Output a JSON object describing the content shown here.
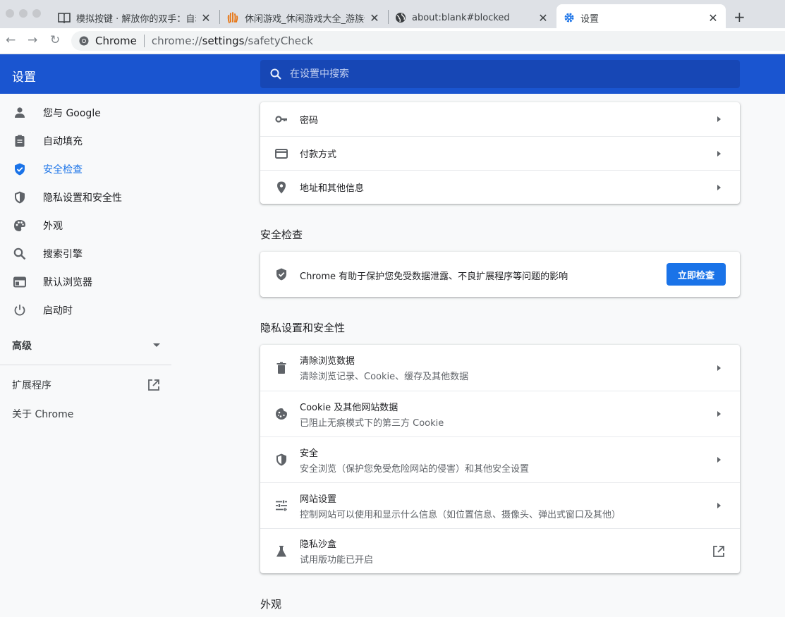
{
  "browser": {
    "tabs": [
      {
        "title": "模拟按键 · 解放你的双手：自动化"
      },
      {
        "title": "休闲游戏_休闲游戏大全_游族休闲"
      },
      {
        "title": "about:blank#blocked"
      },
      {
        "title": "设置"
      }
    ],
    "omnibox": {
      "site": "Chrome",
      "url_host": "chrome://",
      "url_path": "settings",
      "url_rest": "/safetyCheck"
    }
  },
  "header": {
    "title": "设置",
    "search_placeholder": "在设置中搜索"
  },
  "sidebar": {
    "items": [
      {
        "label": "您与 Google"
      },
      {
        "label": "自动填充"
      },
      {
        "label": "安全检查"
      },
      {
        "label": "隐私设置和安全性"
      },
      {
        "label": "外观"
      },
      {
        "label": "搜索引擎"
      },
      {
        "label": "默认浏览器"
      },
      {
        "label": "启动时"
      }
    ],
    "advanced": "高级",
    "extensions": "扩展程序",
    "about": "关于 Chrome"
  },
  "autofill": {
    "rows": [
      {
        "label": "密码"
      },
      {
        "label": "付款方式"
      },
      {
        "label": "地址和其他信息"
      }
    ]
  },
  "safety_check": {
    "title": "安全检查",
    "description": "Chrome 有助于保护您免受数据泄露、不良扩展程序等问题的影响",
    "button": "立即检查"
  },
  "privacy": {
    "title": "隐私设置和安全性",
    "rows": [
      {
        "label": "清除浏览数据",
        "sub": "清除浏览记录、Cookie、缓存及其他数据"
      },
      {
        "label": "Cookie 及其他网站数据",
        "sub": "已阻止无痕模式下的第三方 Cookie"
      },
      {
        "label": "安全",
        "sub": "安全浏览（保护您免受危险网站的侵害）和其他安全设置"
      },
      {
        "label": "网站设置",
        "sub": "控制网站可以使用和显示什么信息（如位置信息、摄像头、弹出式窗口及其他）"
      },
      {
        "label": "隐私沙盒",
        "sub": "试用版功能已开启"
      }
    ]
  },
  "appearance": {
    "title": "外观"
  }
}
